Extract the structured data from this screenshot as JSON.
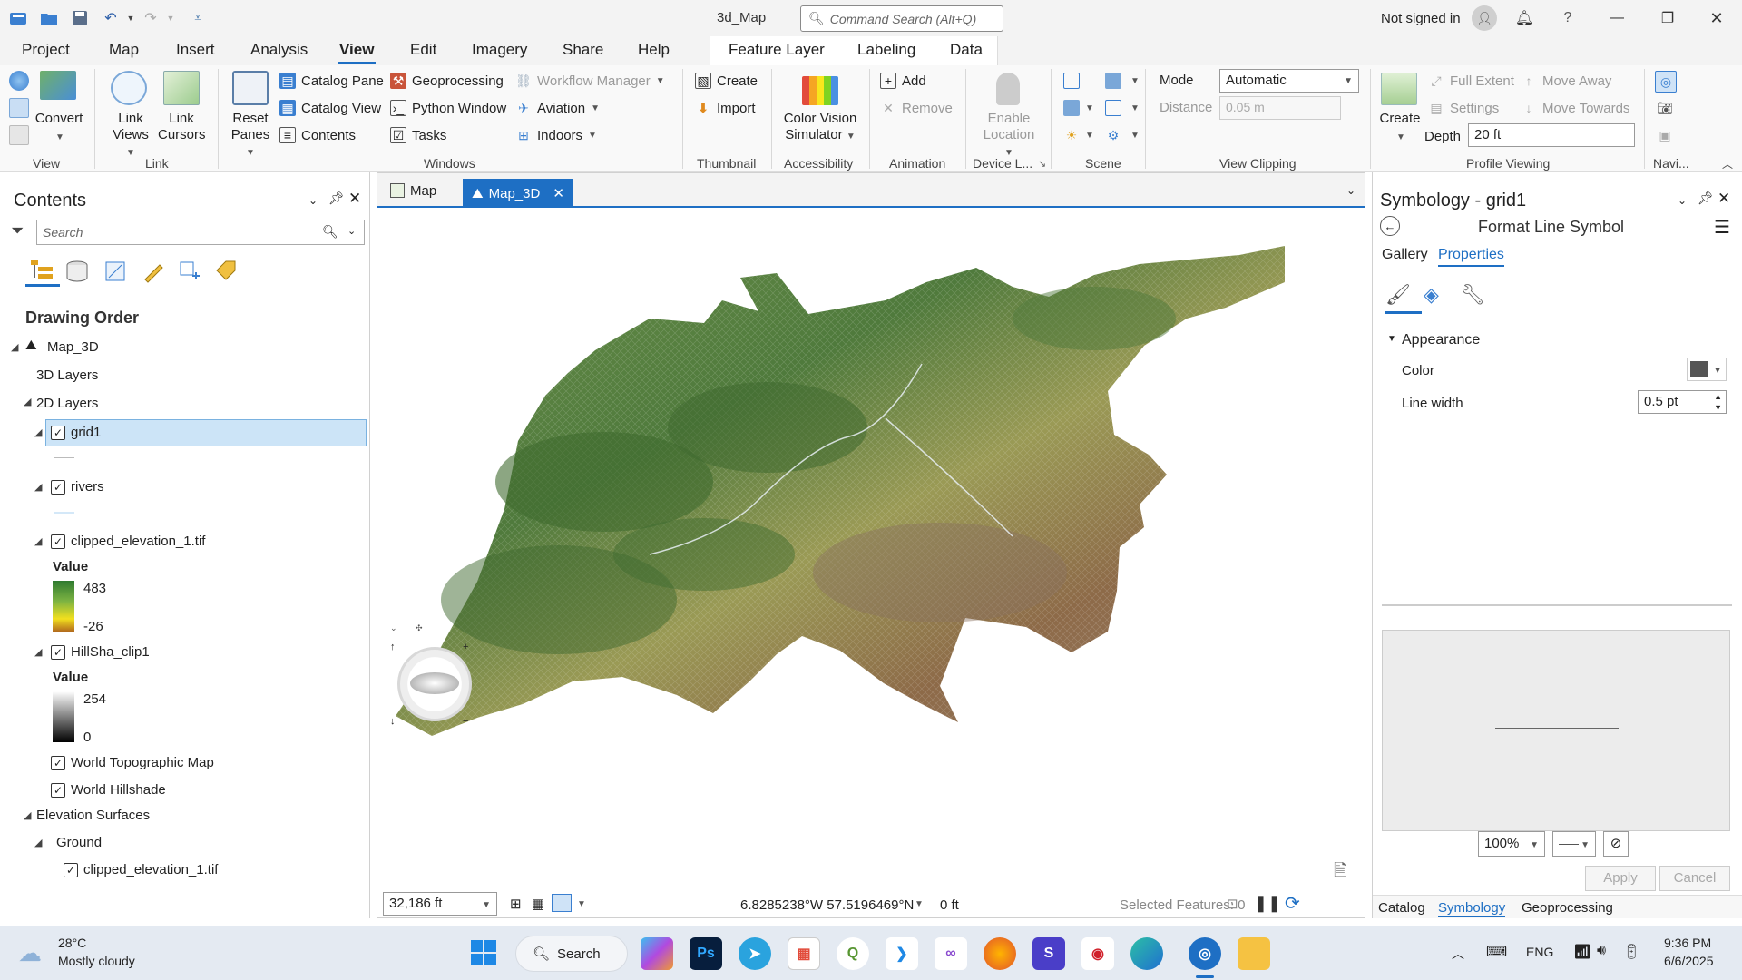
{
  "title_bar": {
    "doc_title": "3d_Map",
    "command_search_placeholder": "Command Search (Alt+Q)",
    "sign_in": "Not signed in",
    "help": "?"
  },
  "menu": {
    "items": [
      "Project",
      "Map",
      "Insert",
      "Analysis",
      "View",
      "Edit",
      "Imagery",
      "Share",
      "Help"
    ],
    "active": "View",
    "context_tabs": [
      "Feature Layer",
      "Labeling",
      "Data"
    ]
  },
  "ribbon": {
    "view_group": {
      "convert": "Convert",
      "label": "View"
    },
    "link_group": {
      "link_views": "Link Views",
      "link_cursors": "Link Cursors",
      "label": "Link"
    },
    "windows_group": {
      "reset_panes": "Reset Panes",
      "catalog_pane": "Catalog Pane",
      "catalog_view": "Catalog View",
      "contents": "Contents",
      "geoprocessing": "Geoprocessing",
      "python_window": "Python Window",
      "tasks": "Tasks",
      "workflow_manager": "Workflow Manager",
      "aviation": "Aviation",
      "indoors": "Indoors",
      "label": "Windows"
    },
    "thumbnail_group": {
      "create": "Create",
      "import": "Import",
      "label": "Thumbnail"
    },
    "accessibility_group": {
      "color_vision": "Color Vision Simulator",
      "label": "Accessibility"
    },
    "animation_group": {
      "add": "Add",
      "remove": "Remove",
      "label": "Animation"
    },
    "device_group": {
      "enable_location": "Enable Location",
      "label": "Device L..."
    },
    "scene_group": {
      "label": "Scene"
    },
    "clipping_group": {
      "mode_label": "Mode",
      "mode_value": "Automatic",
      "distance_label": "Distance",
      "distance_value": "0.05  m",
      "label": "View Clipping"
    },
    "profile_group": {
      "create": "Create",
      "full_extent": "Full Extent",
      "settings": "Settings",
      "move_away": "Move Away",
      "move_towards": "Move Towards",
      "depth_label": "Depth",
      "depth_value": "20 ft",
      "label": "Profile Viewing"
    },
    "nav_group": {
      "label": "Navi..."
    }
  },
  "contents": {
    "title": "Contents",
    "search_placeholder": "Search",
    "drawing_order": "Drawing Order",
    "map_name": "Map_3D",
    "layers_3d": "3D Layers",
    "layers_2d": "2D Layers",
    "grid1": "grid1",
    "rivers": "rivers",
    "elev": "clipped_elevation_1.tif",
    "value_label": "Value",
    "elev_max": "483",
    "elev_min": "-26",
    "hillshade": "HillSha_clip1",
    "hs_max": "254",
    "hs_min": "0",
    "world_topo": "World Topographic Map",
    "world_hillshade": "World Hillshade",
    "elev_surfaces": "Elevation Surfaces",
    "ground": "Ground",
    "ground_layer": "clipped_elevation_1.tif"
  },
  "map": {
    "tabs": [
      "Map",
      "Map_3D"
    ],
    "active_tab": "Map_3D",
    "scale": "32,186 ft",
    "coords": "6.8285238°W 57.5196469°N",
    "elevation": "0 ft",
    "selected": "Selected Features: 0"
  },
  "symbology": {
    "title": "Symbology - grid1",
    "subtitle": "Format Line Symbol",
    "tabs": [
      "Gallery",
      "Properties"
    ],
    "active_tab": "Properties",
    "appearance": "Appearance",
    "color_label": "Color",
    "color_value": "#555555",
    "line_width_label": "Line width",
    "line_width_value": "0.5 pt",
    "zoom": "100%",
    "apply": "Apply",
    "cancel": "Cancel",
    "bottom_tabs": [
      "Catalog",
      "Symbology",
      "Geoprocessing"
    ],
    "active_bottom_tab": "Symbology"
  },
  "taskbar": {
    "temp": "28°C",
    "weather": "Mostly cloudy",
    "search": "Search",
    "lang": "ENG",
    "time": "9:36 PM",
    "date": "6/6/2025"
  },
  "colors": {
    "accent": "#1e6fc4",
    "selection": "#cce4f7"
  }
}
